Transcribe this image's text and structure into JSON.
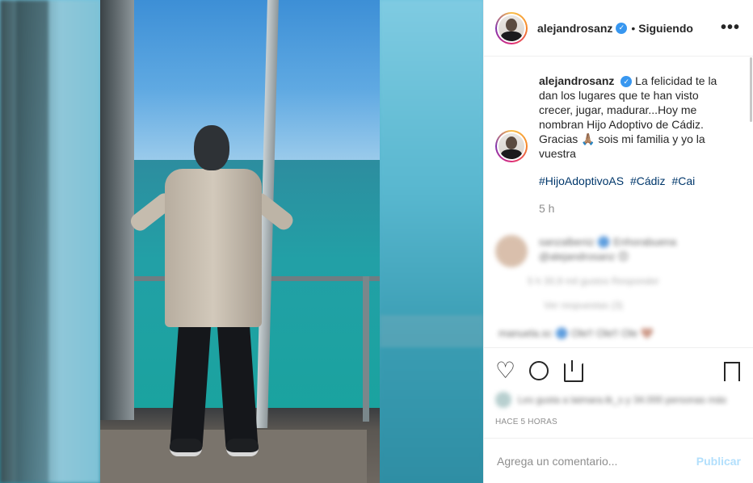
{
  "header": {
    "username": "alejandrosanz",
    "verified_icon": "verified-badge-icon",
    "separator": "•",
    "follow_status": "Siguiendo",
    "more_icon": "more-options-icon",
    "more_label": "•••"
  },
  "caption": {
    "username": "alejandrosanz",
    "text": "La felicidad te la dan los lugares que te han visto crecer, jugar, madurar...Hoy me nombran Hijo Adoptivo de Cádiz. Gracias 🙏🏽 sois mi familia y yo la vuestra",
    "hashtags": [
      "#HijoAdoptivoAS",
      "#Cádiz",
      "#Cai"
    ],
    "time": "5 h"
  },
  "blurred_comment": {
    "author_text": "sanzalbeniz 🔵 Enhorabuena @alejandrosanz 😊",
    "meta": "5 h   30,9 mil gustos   Responder",
    "replies": "Ver respuestas (3)",
    "next_comment": "manuela.sc 🔵 Ole!! Ole!! Ole 🤎"
  },
  "actions": {
    "icons": [
      "heart-icon",
      "comment-icon",
      "share-icon",
      "bookmark-icon"
    ],
    "likes_text": "Les gusta a laimara.tk_s y 34.000 personas más",
    "posted": "HACE 5 HORAS"
  },
  "comment_box": {
    "placeholder": "Agrega un comentario...",
    "publish_label": "Publicar",
    "publish_color": "#b2dffc"
  },
  "colors": {
    "verified": "#3897f0",
    "hashtag": "#00376b",
    "muted": "#8e8e8e"
  }
}
